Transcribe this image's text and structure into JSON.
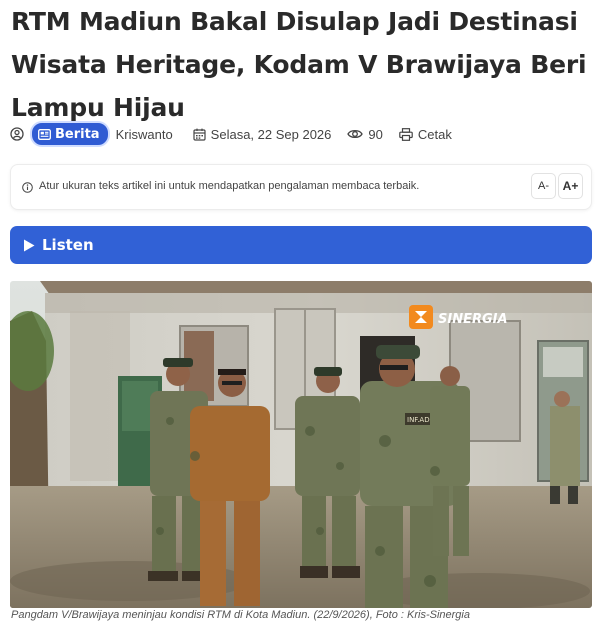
{
  "article": {
    "title": "RTM Madiun Bakal Disulap Jadi Destinasi Wisata Heritage, Kodam V Brawijaya Beri Lampu Hijau",
    "category": "Berita",
    "author": "Kriswanto",
    "date": "Selasa, 22 Sep 2026",
    "views": "90",
    "print_label": "Cetak"
  },
  "notice": {
    "text": "Atur ukuran teks artikel ini untuk mendapatkan pengalaman membaca terbaik.",
    "decrease_label": "A-",
    "increase_label": "A+"
  },
  "audio": {
    "listen_label": "Listen"
  },
  "photo": {
    "watermark": "SINERGIA",
    "patch_text": "INF.AD",
    "caption": "Pangdam V/Brawijaya meninjau kondisi RTM di Kota Madiun. (22/9/2026), Foto : Kris-Sinergia"
  },
  "colors": {
    "accent": "#3161d6",
    "badge": "#2f5bd3",
    "title": "#2a2a2a",
    "watermark_orange": "#f28a1e"
  },
  "icons": [
    "user-icon",
    "newspaper-icon",
    "calendar-icon",
    "eye-icon",
    "printer-icon",
    "info-icon",
    "play-icon",
    "sinergia-logo-icon"
  ]
}
